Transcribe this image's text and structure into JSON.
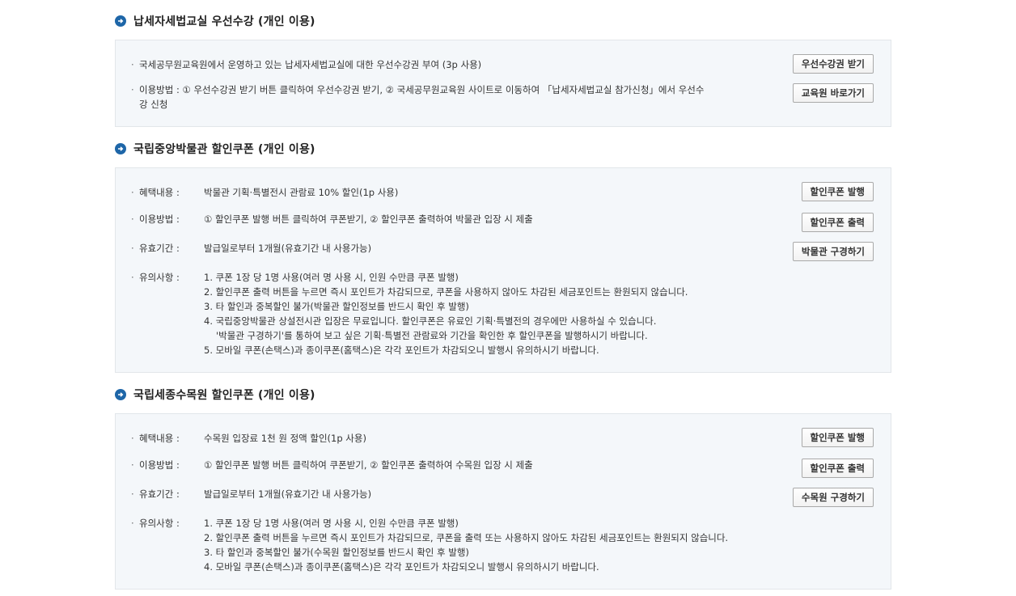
{
  "sections": [
    {
      "title": "납세자세법교실 우선수강 (개인 이용)",
      "rows": [
        {
          "label": "국세공무원교육원에서 운영하고 있는 납세자세법교실에 대한 우선수강권 부여 (3p 사용)"
        },
        {
          "label": "이용방법 : ① 우선수강권 받기 버튼 클릭하여 우선수강권 받기, ② 국세공무원교육원 사이트로 이동하여 「납세자세법교실 참가신청」에서 우선수",
          "label2": "강 신청"
        }
      ],
      "buttons": [
        "우선수강권 받기",
        "교육원 바로가기"
      ]
    },
    {
      "title": "국립중앙박물관 할인쿠폰 (개인 이용)",
      "rows": [
        {
          "label": "혜택내용 :",
          "value": "박물관 기획·특별전시 관람료 10% 할인(1p 사용)"
        },
        {
          "label": "이용방법 :",
          "value": "① 할인쿠폰 발행 버튼 클릭하여 쿠폰받기, ② 할인쿠폰 출력하여 박물관 입장 시 제출"
        },
        {
          "label": "유효기간 :",
          "value": "발급일로부터 1개월(유효기간 내 사용가능)"
        },
        {
          "label": "유의사항 :",
          "notes": [
            "1. 쿠폰 1장 당 1명 사용(여러 명 사용 시, 인원 수만큼 쿠폰 발행)",
            "2. 할인쿠폰 출력 버튼을 누르면 즉시 포인트가 차감되므로, 쿠폰을 사용하지 않아도 차감된 세금포인트는 환원되지 않습니다.",
            "3. 타 할인과 중복할인 불가(박물관 할인정보를 반드시 확인 후 발행)",
            "4. 국립중앙박물관 상설전시관 입장은 무료입니다. 할인쿠폰은 유료인 기획·특별전의 경우에만 사용하실 수 있습니다.",
            "'박물관 구경하기'를 통하여 보고 싶은 기획·특별전 관람료와 기간을 확인한 후 할인쿠폰을 발행하시기 바랍니다.",
            "5. 모바일 쿠폰(손택스)과 종이쿠폰(홈택스)은 각각 포인트가 차감되오니 발행시 유의하시기 바랍니다."
          ]
        }
      ],
      "buttons": [
        "할인쿠폰 발행",
        "할인쿠폰 출력",
        "박물관 구경하기"
      ]
    },
    {
      "title": "국립세종수목원 할인쿠폰 (개인 이용)",
      "rows": [
        {
          "label": "혜택내용 :",
          "value": "수목원 입장료 1천 원 정액 할인(1p 사용)"
        },
        {
          "label": "이용방법 :",
          "value": "① 할인쿠폰 발행 버튼 클릭하여 쿠폰받기, ② 할인쿠폰 출력하여 수목원 입장 시 제출"
        },
        {
          "label": "유효기간 :",
          "value": "발급일로부터 1개월(유효기간 내 사용가능)"
        },
        {
          "label": "유의사항 :",
          "notes": [
            "1. 쿠폰 1장 당 1명 사용(여러 명 사용 시, 인원 수만큼 쿠폰 발행)",
            "2. 할인쿠폰 출력 버튼을 누르면 즉시 포인트가 차감되므로, 쿠폰을 출력 또는 사용하지 않아도 차감된 세금포인트는 환원되지 않습니다.",
            "3. 타 할인과 중복할인 불가(수목원 할인정보를 반드시 확인 후 발행)",
            "4. 모바일 쿠폰(손택스)과 종이쿠폰(홈택스)은 각각 포인트가 차감되오니 발행시 유의하시기 바랍니다."
          ]
        }
      ],
      "buttons": [
        "할인쿠폰 발행",
        "할인쿠폰 출력",
        "수목원 구경하기"
      ]
    }
  ],
  "bullet": "·",
  "colors": {
    "accent": "#1e66a8",
    "box_bg": "#f4f7fa",
    "box_border": "#e2e6ea"
  },
  "icons": {
    "section_marker": "arrow-circle-icon"
  }
}
